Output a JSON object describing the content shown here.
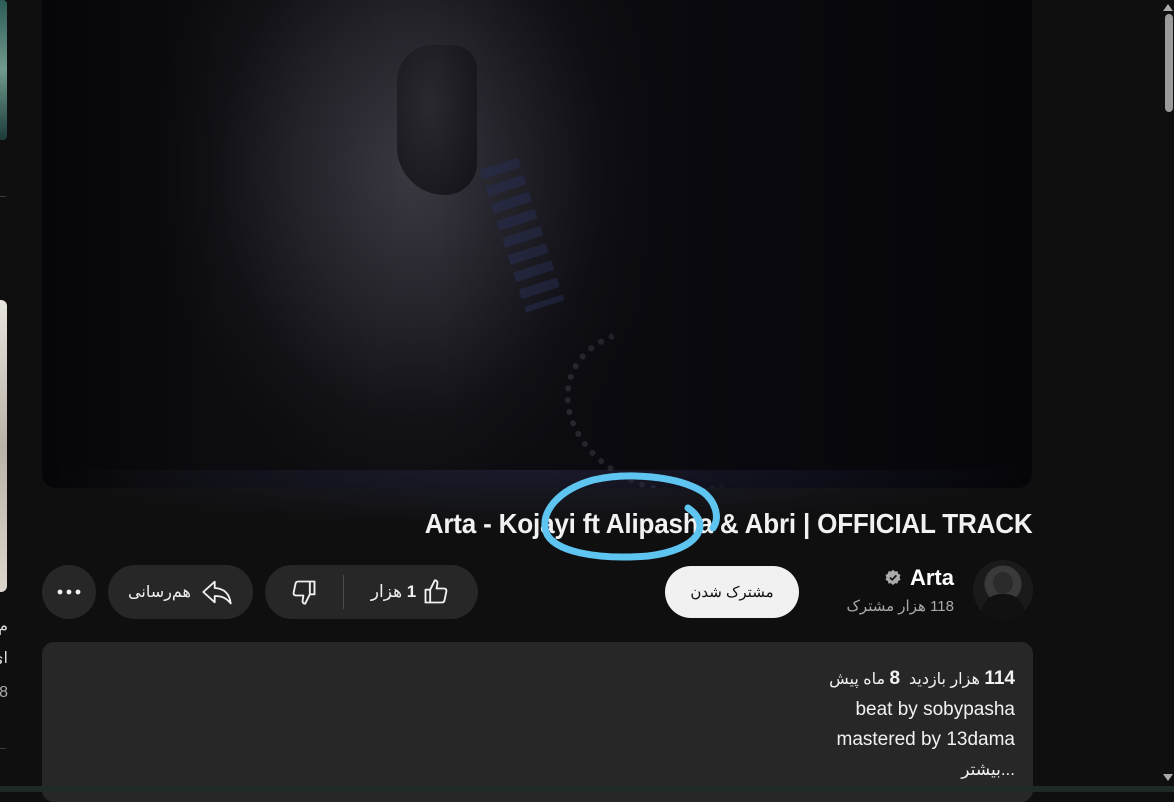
{
  "video": {
    "title": "Arta - Kojayi ft Alipasha & Abri | OFFICIAL TRACK"
  },
  "channel": {
    "name": "Arta",
    "subscribers": "118 هزار مشترک",
    "subscribe_label": "مشترک شدن",
    "verified": true
  },
  "actions": {
    "like_count_number": "1",
    "like_count_unit": "هزار",
    "share_label": "هم‌رسانی",
    "more_icon": "more-horizontal-icon"
  },
  "description": {
    "views_number": "114",
    "views_text": "هزار بازدید",
    "age_number": "8",
    "age_text": "ماه پیش",
    "lines": [
      "beat by sobypasha",
      "mastered by 13dama"
    ],
    "more_label": "...بیشتر"
  },
  "sidebar": {
    "partial_text": [
      "م",
      "ای",
      "8"
    ]
  },
  "colors": {
    "background": "#0f0f0f",
    "button": "#272727",
    "annotation": "#5ec4f0",
    "subscribe_bg": "#f1f1f1"
  }
}
